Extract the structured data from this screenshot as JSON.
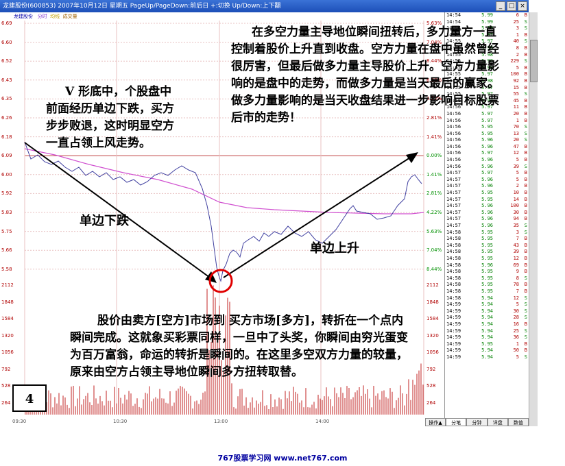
{
  "window": {
    "title": "龙建股份(600853) 2007年10月12日 星期五 PageUp/PageDown:前后日 +:切换 Up/Down:上下翻",
    "btn_min": "_",
    "btn_max": "□",
    "btn_close": "×"
  },
  "legend": {
    "name": "龙建股份",
    "time": "分时",
    "avg": "均线",
    "vol": "成交量"
  },
  "price_axis": [
    "6.69",
    "6.60",
    "6.52",
    "6.43",
    "6.35",
    "6.26",
    "6.18",
    "6.09",
    "6.00",
    "5.92",
    "5.83",
    "5.75",
    "5.66",
    "5.58"
  ],
  "pct_axis": [
    "5.63%",
    "7.04%",
    "8.44%",
    "6.33%",
    "4.22%",
    "2.81%",
    "1.41%",
    "0.00%",
    "1.41%",
    "2.81%",
    "4.22%",
    "5.63%",
    "7.04%",
    "8.44%"
  ],
  "vol_axis": [
    "2112",
    "1848",
    "1584",
    "1320",
    "1056",
    "792",
    "528",
    "264"
  ],
  "time_axis": [
    "09:30",
    "10:30",
    "13:00",
    "14:00"
  ],
  "ticks": [
    {
      "t": "14:54",
      "p": "5.99",
      "v": "6",
      "s": "B"
    },
    {
      "t": "14:54",
      "p": "5.99",
      "v": "25",
      "s": "S"
    },
    {
      "t": "14:54",
      "p": "5.99",
      "v": "3",
      "s": "S"
    },
    {
      "t": "14:55",
      "p": "5.97",
      "v": "1",
      "s": "B"
    },
    {
      "t": "14:55",
      "p": "5.97",
      "v": "40",
      "s": "S"
    },
    {
      "t": "14:55",
      "p": "5.97",
      "v": "8",
      "s": "B"
    },
    {
      "t": "14:55",
      "p": "5.98",
      "v": "2",
      "s": "B"
    },
    {
      "t": "14:55",
      "p": "5.98",
      "v": "229",
      "s": "S"
    },
    {
      "t": "14:55",
      "p": "5.98",
      "v": "5",
      "s": "B"
    },
    {
      "t": "14:55",
      "p": "5.97",
      "v": "100",
      "s": "B"
    },
    {
      "t": "14:55",
      "p": "5.98",
      "v": "92",
      "s": "B"
    },
    {
      "t": "14:55",
      "p": "5.97",
      "v": "15",
      "s": "B"
    },
    {
      "t": "14:55",
      "p": "5.97",
      "v": "55",
      "s": "S"
    },
    {
      "t": "14:56",
      "p": "5.97",
      "v": "45",
      "s": "B"
    },
    {
      "t": "14:56",
      "p": "5.97",
      "v": "11",
      "s": "B"
    },
    {
      "t": "14:56",
      "p": "5.97",
      "v": "20",
      "s": "B"
    },
    {
      "t": "14:56",
      "p": "5.97",
      "v": "1",
      "s": "B"
    },
    {
      "t": "14:56",
      "p": "5.95",
      "v": "70",
      "s": "S"
    },
    {
      "t": "14:56",
      "p": "5.95",
      "v": "13",
      "s": "S"
    },
    {
      "t": "14:56",
      "p": "5.96",
      "v": "20",
      "s": "S"
    },
    {
      "t": "14:56",
      "p": "5.96",
      "v": "47",
      "s": "B"
    },
    {
      "t": "14:56",
      "p": "5.97",
      "v": "12",
      "s": "B"
    },
    {
      "t": "14:56",
      "p": "5.96",
      "v": "5",
      "s": "B"
    },
    {
      "t": "14:56",
      "p": "5.96",
      "v": "39",
      "s": "S"
    },
    {
      "t": "14:57",
      "p": "5.97",
      "v": "5",
      "s": "B"
    },
    {
      "t": "14:57",
      "p": "5.96",
      "v": "5",
      "s": "B"
    },
    {
      "t": "14:57",
      "p": "5.96",
      "v": "2",
      "s": "B"
    },
    {
      "t": "14:57",
      "p": "5.95",
      "v": "10",
      "s": "B"
    },
    {
      "t": "14:57",
      "p": "5.95",
      "v": "14",
      "s": "B"
    },
    {
      "t": "14:57",
      "p": "5.96",
      "v": "100",
      "s": "B"
    },
    {
      "t": "14:57",
      "p": "5.96",
      "v": "30",
      "s": "B"
    },
    {
      "t": "14:57",
      "p": "5.96",
      "v": "94",
      "s": "B"
    },
    {
      "t": "14:57",
      "p": "5.96",
      "v": "35",
      "s": "S"
    },
    {
      "t": "14:58",
      "p": "5.95",
      "v": "3",
      "s": "S"
    },
    {
      "t": "14:58",
      "p": "5.95",
      "v": "7",
      "s": "B"
    },
    {
      "t": "14:58",
      "p": "5.95",
      "v": "43",
      "s": "B"
    },
    {
      "t": "14:58",
      "p": "5.95",
      "v": "39",
      "s": "B"
    },
    {
      "t": "14:58",
      "p": "5.95",
      "v": "12",
      "s": "B"
    },
    {
      "t": "14:58",
      "p": "5.96",
      "v": "69",
      "s": "B"
    },
    {
      "t": "14:58",
      "p": "5.95",
      "v": "9",
      "s": "B"
    },
    {
      "t": "14:58",
      "p": "5.95",
      "v": "8",
      "s": "S"
    },
    {
      "t": "14:58",
      "p": "5.95",
      "v": "78",
      "s": "B"
    },
    {
      "t": "14:58",
      "p": "5.95",
      "v": "7",
      "s": "B"
    },
    {
      "t": "14:58",
      "p": "5.94",
      "v": "12",
      "s": "S"
    },
    {
      "t": "14:59",
      "p": "5.94",
      "v": "5",
      "s": "S"
    },
    {
      "t": "14:59",
      "p": "5.94",
      "v": "30",
      "s": "S"
    },
    {
      "t": "14:59",
      "p": "5.94",
      "v": "28",
      "s": "S"
    },
    {
      "t": "14:59",
      "p": "5.94",
      "v": "16",
      "s": "B"
    },
    {
      "t": "14:59",
      "p": "5.94",
      "v": "25",
      "s": "S"
    },
    {
      "t": "14:59",
      "p": "5.94",
      "v": "36",
      "s": "S"
    },
    {
      "t": "14:59",
      "p": "5.95",
      "v": "1",
      "s": "B"
    },
    {
      "t": "14:59",
      "p": "5.94",
      "v": "50",
      "s": "B"
    },
    {
      "t": "14:59",
      "p": "5.94",
      "v": "5",
      "s": "S"
    }
  ],
  "tabs": [
    "操作▲",
    "分笔",
    "分钟",
    "详盘",
    "数值"
  ],
  "captions": {
    "top_right": "在多空力量主导地位瞬间扭转后，多力量方一直控制着股价上升直到收盘。空方力量在盘中虽然曾经很厉害，但最后做多力量主导股价上升。空方力量影响的是盘中的走势，而做多力量是当天最后的赢家。做多力量影响的是当天收盘结果进一步影响目标股票后市的走势！",
    "left": "V 形底中，个股盘中前面经历单边下跌，买方步步败退，这时明显空方一直占领上风走势。",
    "bottom": "股价由卖方[空方]市场到 买方市场[多方]，转折在一个点内瞬间完成。这就象买彩票同样，一旦中了头奖，你瞬间由穷光蛋变为百万富翁，命运的转折是瞬间的。在这里多空双方力量的较量，原来由空方占领主导地位瞬间多方扭转取替。"
  },
  "labels": {
    "down": "单边下跌",
    "up": "单边上升",
    "page_num": "4"
  },
  "footer": "767股票学习网 www.net767.com",
  "colors": {
    "price_line": "#4040a0",
    "avg_line": "#d050d0",
    "volume_bar": "#c02020",
    "arrow": "#000000",
    "circle": "#e00000"
  }
}
